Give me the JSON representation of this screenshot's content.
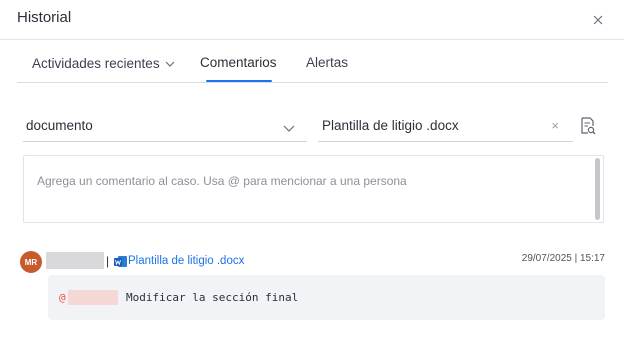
{
  "header": {
    "title": "Historial",
    "close_icon": "close-icon"
  },
  "tabs": [
    {
      "label": "Actividades recientes",
      "has_dropdown": true
    },
    {
      "label": "Comentarios",
      "active": true
    },
    {
      "label": "Alertas"
    }
  ],
  "filters": {
    "entity_select": {
      "value": "documento"
    },
    "file_select": {
      "value": "Plantilla de litigio .docx",
      "clear_icon": "×"
    },
    "search_document_icon": "document-search-icon"
  },
  "composer": {
    "placeholder": "Agrega un comentario al caso. Usa @ para mencionar a una persona"
  },
  "comments": [
    {
      "avatar_initials": "MR",
      "separator": "|",
      "file_name": "Plantilla de litigio .docx",
      "file_icon": "word-icon",
      "timestamp": "29/07/2025 | 15:17",
      "mention_prefix": "@",
      "text": "Modificar la sección final"
    }
  ],
  "colors": {
    "accent": "#1a73e8",
    "avatar": "#c75b2e",
    "mention": "#e8543a",
    "bubble": "#f1f3f7"
  }
}
